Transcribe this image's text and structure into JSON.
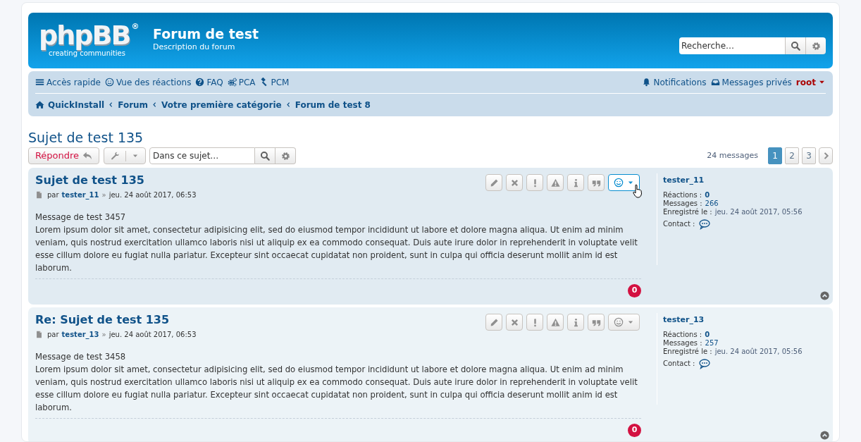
{
  "header": {
    "logo": {
      "wordmark": "phpBB",
      "registered": "®",
      "tagline": "creating communities"
    },
    "site_title": "Forum de test",
    "site_description": "Description du forum",
    "search": {
      "placeholder": "Recherche…"
    }
  },
  "navbar": {
    "quick_links": [
      {
        "label": "Accès rapide"
      },
      {
        "label": "Vue des réactions"
      },
      {
        "label": "FAQ"
      },
      {
        "label": "PCA"
      },
      {
        "label": "PCM"
      }
    ],
    "user_links": [
      {
        "label": "Notifications"
      },
      {
        "label": "Messages privés"
      }
    ],
    "username": "root"
  },
  "breadcrumbs": [
    {
      "label": "QuickInstall"
    },
    {
      "label": "Forum"
    },
    {
      "label": "Votre première catégorie"
    },
    {
      "label": "Forum de test 8"
    }
  ],
  "topic": {
    "title": "Sujet de test 135",
    "reply_button": "Répondre",
    "search_placeholder": "Dans ce sujet…",
    "message_count": "24 messages",
    "pages": [
      {
        "label": "1",
        "selected": true
      },
      {
        "label": "2",
        "selected": false
      },
      {
        "label": "3",
        "selected": false
      }
    ]
  },
  "posts": [
    {
      "title": "Sujet de test 135",
      "by": "par",
      "author": "tester_11",
      "separator": "»",
      "date": "jeu. 24 août 2017, 06:53",
      "first_line": "Message de test 3457",
      "body": "Lorem ipsum dolor sit amet, consectetur adipisicing elit, sed do eiusmod tempor incididunt ut labore et dolore magna aliqua. Ut enim ad minim veniam, quis nostrud exercitation ullamco laboris nisi ut aliquip ex ea commodo consequat. Duis aute irure dolor in reprehenderit in voluptate velit esse cillum dolore eu fugiat nulla pariatur. Excepteur sint occaecat cupidatat non proident, sunt in culpa qui officia deserunt mollit anim id est laborum.",
      "reaction_count": "0",
      "reaction_button_active": true,
      "profile": {
        "username": "tester_11",
        "fields": [
          {
            "label": "Réactions :",
            "value": "0",
            "kind": "bold"
          },
          {
            "label": "Messages :",
            "value": "266",
            "kind": "link"
          },
          {
            "label": "Enregistré le :",
            "value": "jeu. 24 août 2017, 05:56",
            "kind": "plain"
          }
        ],
        "contact_label": "Contact :"
      }
    },
    {
      "title": "Re: Sujet de test 135",
      "by": "par",
      "author": "tester_13",
      "separator": "»",
      "date": "jeu. 24 août 2017, 06:53",
      "first_line": "Message de test 3458",
      "body": "Lorem ipsum dolor sit amet, consectetur adipisicing elit, sed do eiusmod tempor incididunt ut labore et dolore magna aliqua. Ut enim ad minim veniam, quis nostrud exercitation ullamco laboris nisi ut aliquip ex ea commodo consequat. Duis aute irure dolor in reprehenderit in voluptate velit esse cillum dolore eu fugiat nulla pariatur. Excepteur sint occaecat cupidatat non proident, sunt in culpa qui officia deserunt mollit anim id est laborum.",
      "reaction_count": "0",
      "reaction_button_active": false,
      "profile": {
        "username": "tester_13",
        "fields": [
          {
            "label": "Réactions :",
            "value": "0",
            "kind": "bold"
          },
          {
            "label": "Messages :",
            "value": "257",
            "kind": "link"
          },
          {
            "label": "Enregistré le :",
            "value": "jeu. 24 août 2017, 05:56",
            "kind": "plain"
          }
        ],
        "contact_label": "Contact :"
      }
    }
  ]
}
